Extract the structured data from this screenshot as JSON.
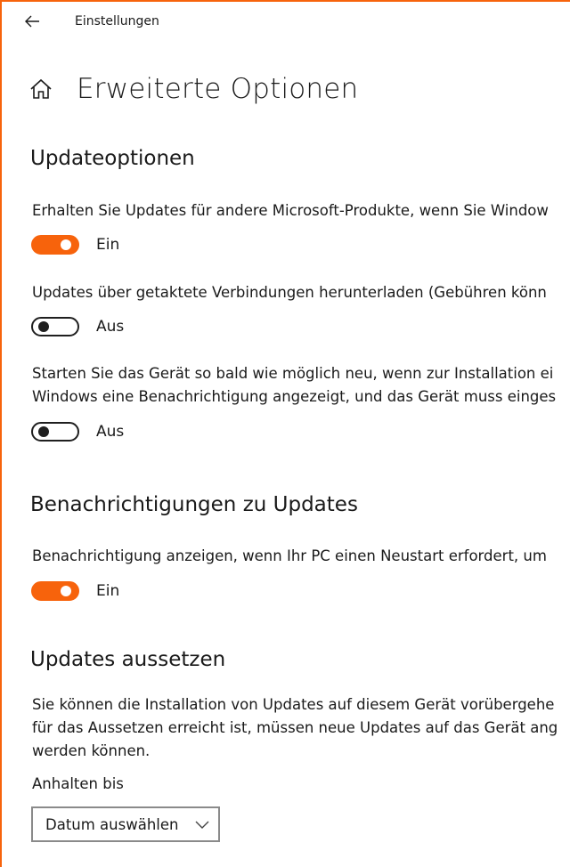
{
  "window": {
    "app_title": "Einstellungen",
    "accent_color": "#f7630c"
  },
  "header": {
    "back_icon": "back-arrow-icon",
    "home_icon": "home-icon",
    "page_title": "Erweiterte Optionen"
  },
  "update_options": {
    "title": "Updateoptionen",
    "items": [
      {
        "description": "Erhalten Sie Updates für andere Microsoft-Produkte, wenn Sie Window",
        "toggle_on": true,
        "state_label": "Ein"
      },
      {
        "description": "Updates über getaktete Verbindungen herunterladen (Gebühren könn",
        "toggle_on": false,
        "state_label": "Aus"
      },
      {
        "description_line1": "Starten Sie das Gerät so bald wie möglich neu, wenn zur Installation ei",
        "description_line2": "Windows eine Benachrichtigung angezeigt, und das Gerät muss einges",
        "toggle_on": false,
        "state_label": "Aus"
      }
    ]
  },
  "notifications": {
    "title": "Benachrichtigungen zu Updates",
    "description": "Benachrichtigung anzeigen, wenn Ihr PC einen Neustart erfordert, um",
    "toggle_on": true,
    "state_label": "Ein"
  },
  "pause_updates": {
    "title": "Updates aussetzen",
    "description_line1": "Sie können die Installation von Updates auf diesem Gerät vorübergehe",
    "description_line2": "für das Aussetzen erreicht ist, müssen neue Updates auf das Gerät ang",
    "description_line3": "werden können.",
    "pause_until_label": "Anhalten bis",
    "dropdown_value": "Datum auswählen"
  }
}
